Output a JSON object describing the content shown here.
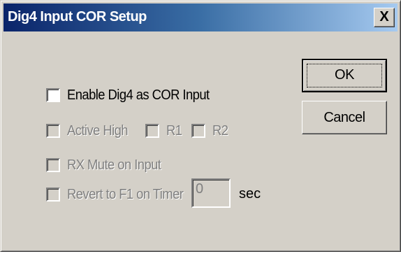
{
  "window": {
    "title": "Dig4 Input COR Setup",
    "close_label": "X"
  },
  "buttons": {
    "ok_label": "OK",
    "cancel_label": "Cancel"
  },
  "options": {
    "enable_cor": {
      "label": "Enable Dig4 as COR Input",
      "checked": false,
      "enabled": true
    },
    "active_high": {
      "label": "Active High",
      "checked": false,
      "enabled": false
    },
    "r1": {
      "label": "R1",
      "checked": false,
      "enabled": false
    },
    "r2": {
      "label": "R2",
      "checked": false,
      "enabled": false
    },
    "rx_mute": {
      "label": "RX Mute on Input",
      "checked": false,
      "enabled": false
    },
    "revert": {
      "label": "Revert to F1 on Timer",
      "checked": false,
      "enabled": false
    }
  },
  "timer": {
    "value": "0",
    "unit": "sec"
  },
  "colors": {
    "dialog_bg": "#d4d0c8",
    "titlebar_start": "#0a246a",
    "titlebar_end": "#a6caf0",
    "disabled_text": "#808080"
  }
}
